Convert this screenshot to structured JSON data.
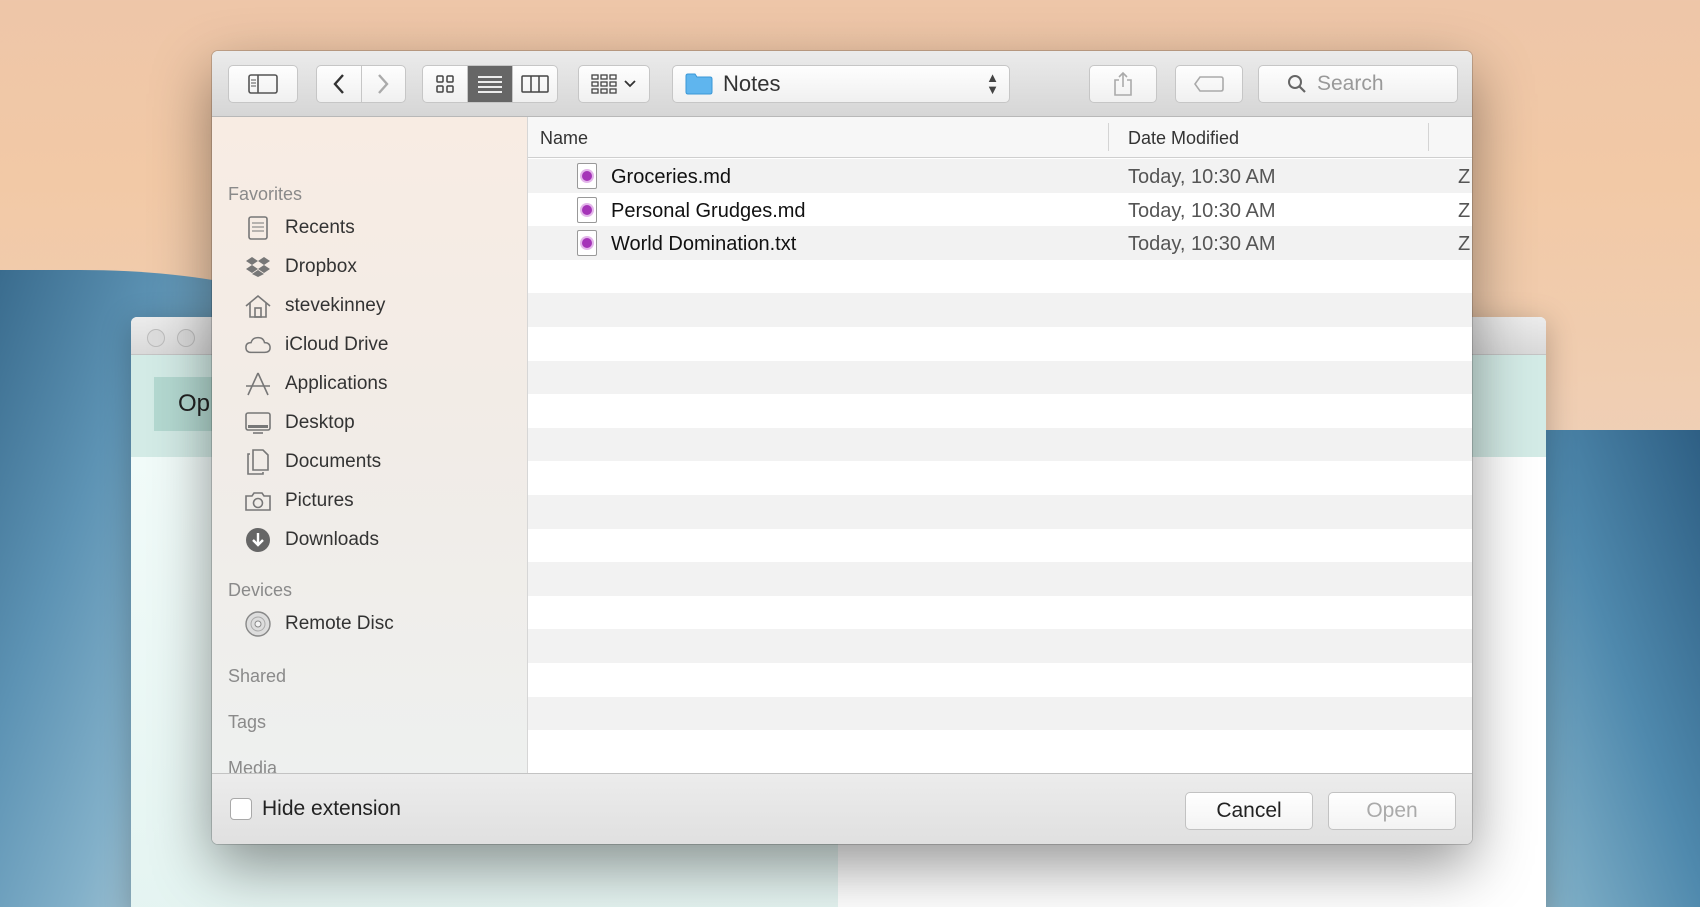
{
  "background_window": {
    "open_button_label": "Op"
  },
  "toolbar": {
    "path": "Notes",
    "search_placeholder": "Search"
  },
  "sidebar": {
    "sections": [
      {
        "header": "Favorites",
        "items": [
          {
            "label": "Recents",
            "icon": "recents-icon"
          },
          {
            "label": "Dropbox",
            "icon": "dropbox-icon"
          },
          {
            "label": "stevekinney",
            "icon": "home-icon"
          },
          {
            "label": "iCloud Drive",
            "icon": "cloud-icon"
          },
          {
            "label": "Applications",
            "icon": "applications-icon"
          },
          {
            "label": "Desktop",
            "icon": "desktop-icon"
          },
          {
            "label": "Documents",
            "icon": "documents-icon"
          },
          {
            "label": "Pictures",
            "icon": "camera-icon"
          },
          {
            "label": "Downloads",
            "icon": "download-icon"
          }
        ]
      },
      {
        "header": "Devices",
        "items": [
          {
            "label": "Remote Disc",
            "icon": "disc-icon"
          }
        ]
      },
      {
        "header": "Shared",
        "items": []
      },
      {
        "header": "Tags",
        "items": []
      },
      {
        "header": "Media",
        "items": []
      }
    ]
  },
  "file_list": {
    "columns": [
      "Name",
      "Date Modified"
    ],
    "files": [
      {
        "name": "Groceries.md",
        "date": "Today, 10:30 AM",
        "extra": "Z"
      },
      {
        "name": "Personal Grudges.md",
        "date": "Today, 10:30 AM",
        "extra": "Z"
      },
      {
        "name": "World Domination.txt",
        "date": "Today, 10:30 AM",
        "extra": "Z"
      }
    ]
  },
  "footer": {
    "hide_extension_label": "Hide extension",
    "hide_extension_checked": false,
    "cancel_label": "Cancel",
    "open_label": "Open"
  }
}
